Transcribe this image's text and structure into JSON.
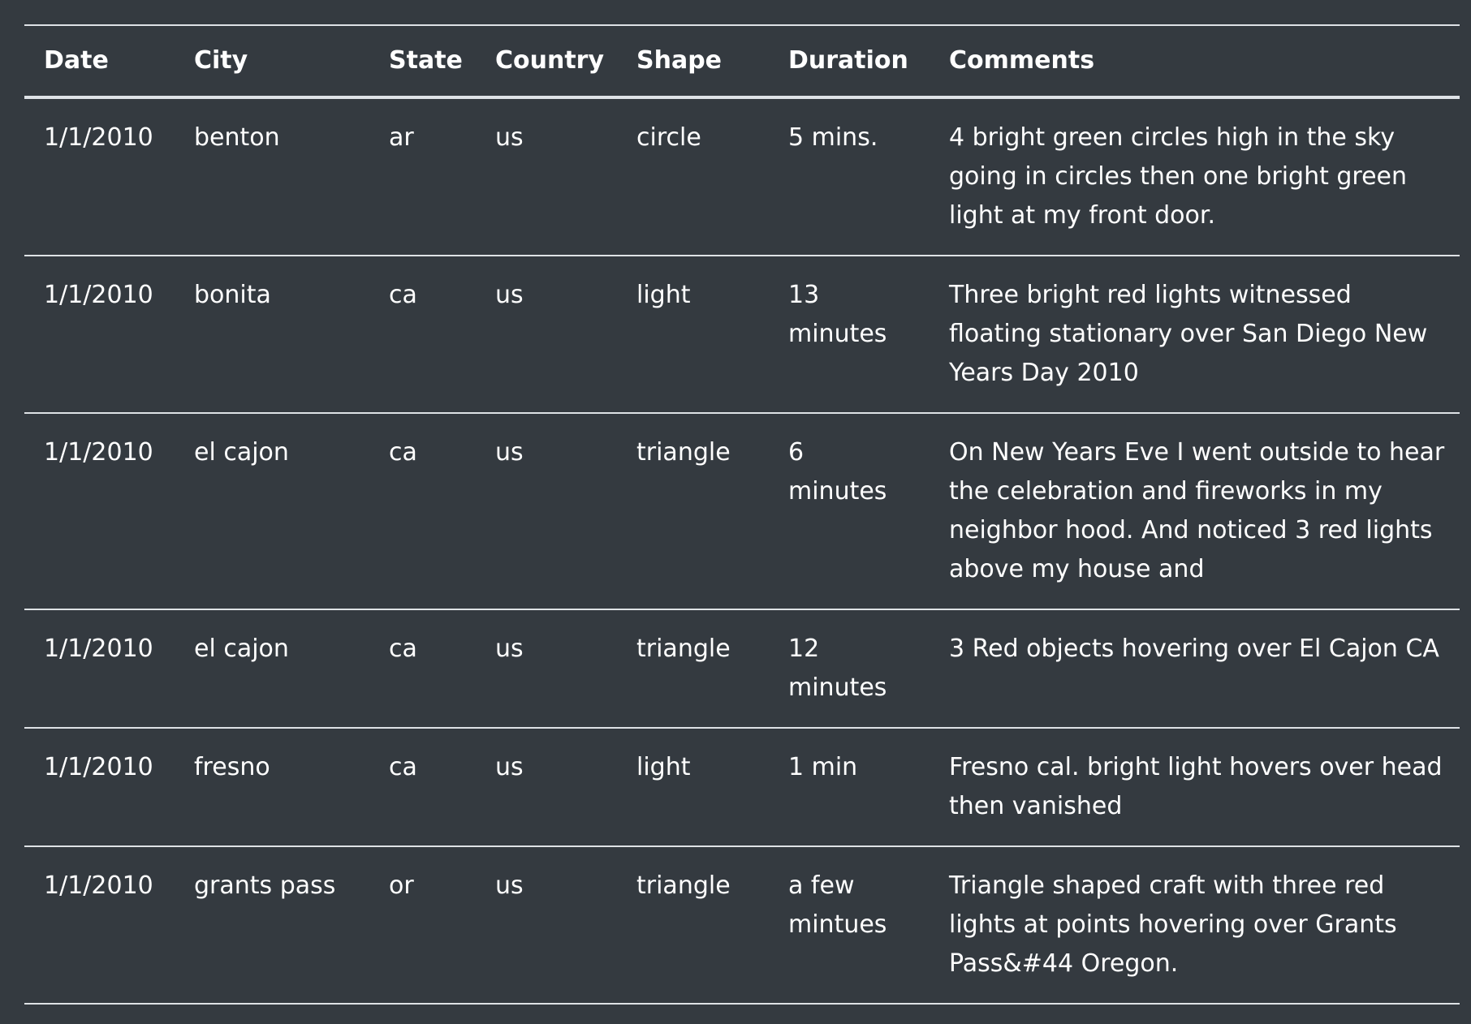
{
  "table": {
    "columns": [
      "Date",
      "City",
      "State",
      "Country",
      "Shape",
      "Duration",
      "Comments"
    ],
    "rows": [
      [
        "1/1/2010",
        "benton",
        "ar",
        "us",
        "circle",
        "5 mins.",
        "4 bright green circles high in the sky going in circles then one bright green light at my front door."
      ],
      [
        "1/1/2010",
        "bonita",
        "ca",
        "us",
        "light",
        "13 minutes",
        "Three bright red lights witnessed floating stationary over San Diego New Years Day 2010"
      ],
      [
        "1/1/2010",
        "el cajon",
        "ca",
        "us",
        "triangle",
        "6 minutes",
        "On New Years Eve I went outside to hear the celebration and fireworks in my neighbor hood. And noticed 3 red lights above my house and"
      ],
      [
        "1/1/2010",
        "el cajon",
        "ca",
        "us",
        "triangle",
        "12 minutes",
        "3 Red objects hovering over El Cajon CA"
      ],
      [
        "1/1/2010",
        "fresno",
        "ca",
        "us",
        "light",
        "1 min",
        "Fresno cal. bright light hovers over head then vanished"
      ],
      [
        "1/1/2010",
        "grants pass",
        "or",
        "us",
        "triangle",
        "a few mintues",
        "Triangle shaped craft with three red lights at points hovering over Grants Pass&#44 Oregon."
      ]
    ]
  },
  "colors": {
    "background": "#343a40",
    "text": "#ffffff",
    "border": "#dee2e6"
  }
}
